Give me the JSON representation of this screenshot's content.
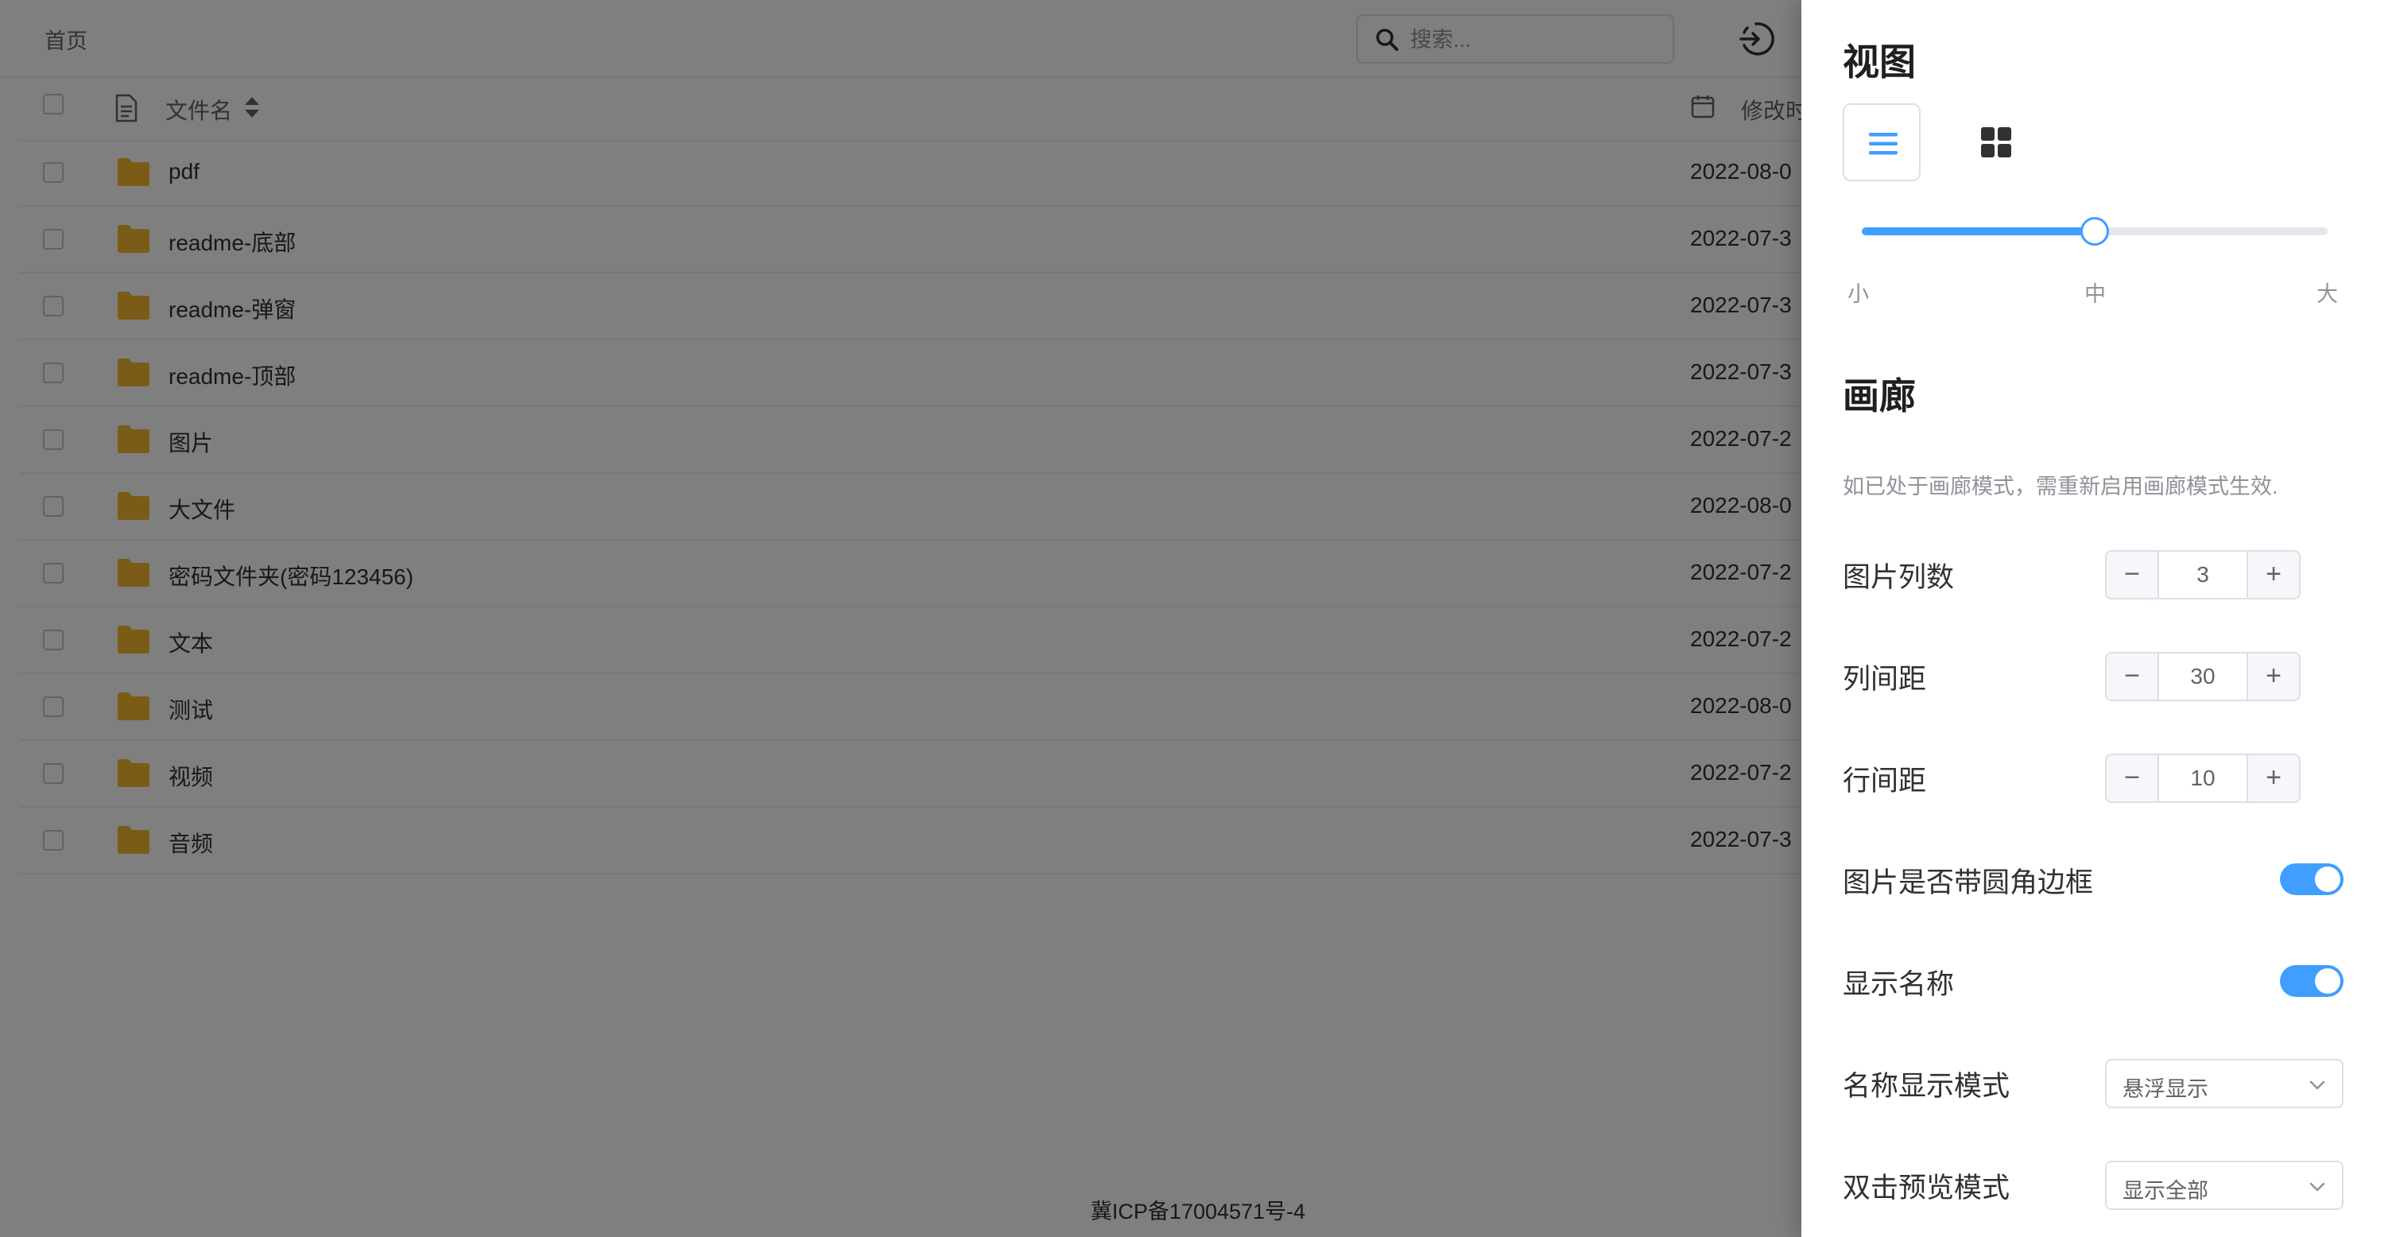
{
  "breadcrumb": "首页",
  "search": {
    "placeholder": "搜索..."
  },
  "list": {
    "header_name": "文件名",
    "header_time": "修改时",
    "rows": [
      {
        "name": "pdf",
        "time": "2022-08-0"
      },
      {
        "name": "readme-底部",
        "time": "2022-07-3"
      },
      {
        "name": "readme-弹窗",
        "time": "2022-07-3"
      },
      {
        "name": "readme-顶部",
        "time": "2022-07-3"
      },
      {
        "name": "图片",
        "time": "2022-07-2"
      },
      {
        "name": "大文件",
        "time": "2022-08-0"
      },
      {
        "name": "密码文件夹(密码123456)",
        "time": "2022-07-2"
      },
      {
        "name": "文本",
        "time": "2022-07-2"
      },
      {
        "name": "测试",
        "time": "2022-08-0"
      },
      {
        "name": "视频",
        "time": "2022-07-2"
      },
      {
        "name": "音频",
        "time": "2022-07-3"
      }
    ]
  },
  "footer": "冀ICP备17004571号-4",
  "drawer": {
    "view_title": "视图",
    "size_slider": {
      "value": 0.5,
      "labels": [
        "小",
        "中",
        "大"
      ]
    },
    "gallery_title": "画廊",
    "gallery_note": "如已处于画廊模式，需重新启用画廊模式生效.",
    "columns_label": "图片列数",
    "columns_value": "3",
    "col_gap_label": "列间距",
    "col_gap_value": "30",
    "row_gap_label": "行间距",
    "row_gap_value": "10",
    "rounded_label": "图片是否带圆角边框",
    "rounded_on": true,
    "show_name_label": "显示名称",
    "show_name_on": true,
    "name_mode_label": "名称显示模式",
    "name_mode_value": "悬浮显示",
    "dblclick_label": "双击预览模式",
    "dblclick_value": "显示全部"
  },
  "colors": {
    "accent": "#409eff",
    "folder": "#f5b82e",
    "overlay": "rgba(0,0,0,0.5)"
  }
}
